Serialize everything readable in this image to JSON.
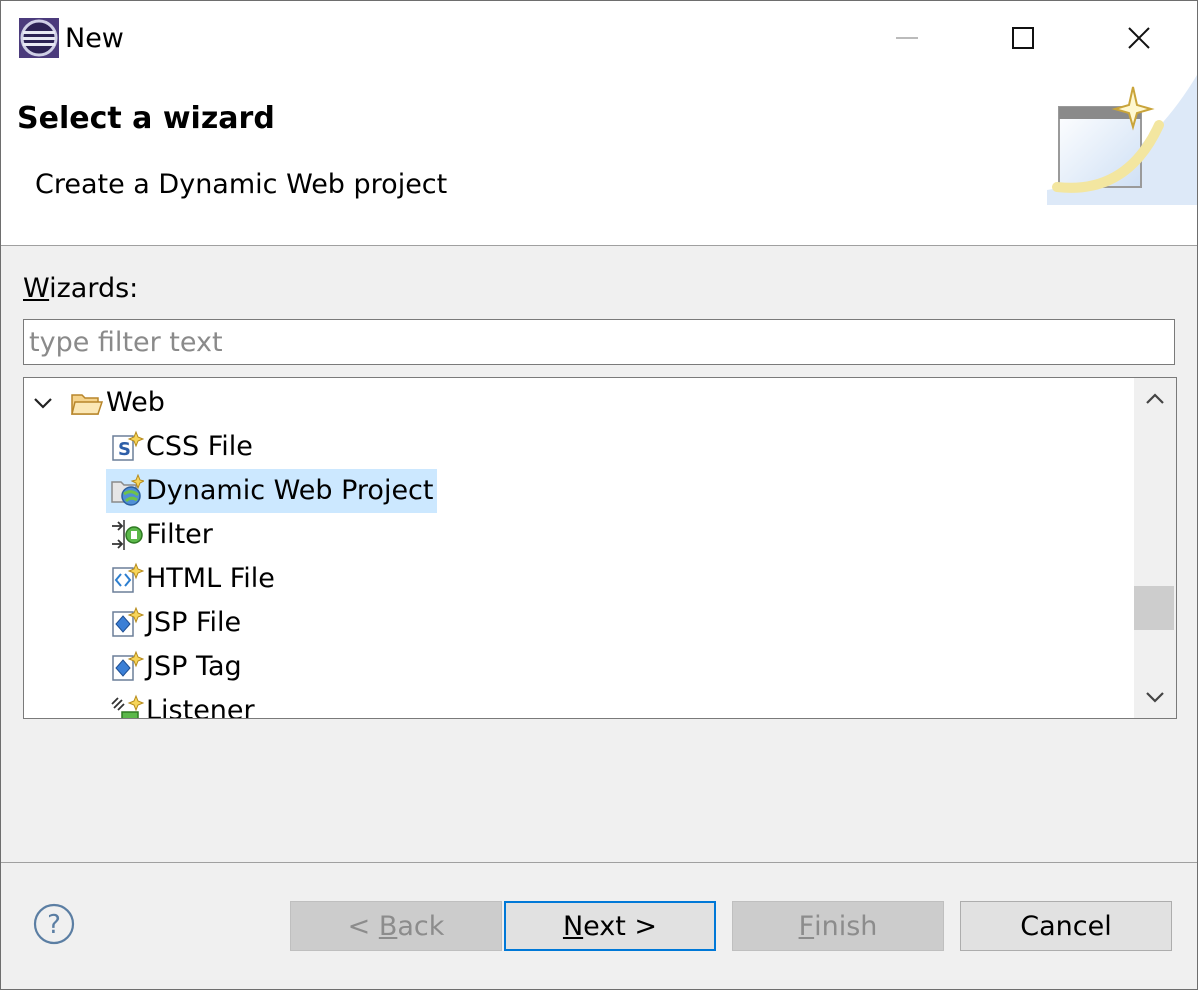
{
  "window": {
    "title": "New",
    "app_icon": "eclipse-icon",
    "controls": [
      "minimize-icon",
      "maximize-icon",
      "close-icon"
    ]
  },
  "header": {
    "title": "Select a wizard",
    "description": "Create a Dynamic Web project"
  },
  "wizards": {
    "label_mnemonic": "W",
    "label_rest": "izards:",
    "filter_placeholder": "type filter text",
    "filter_value": ""
  },
  "tree": {
    "group": {
      "label": "Web",
      "expanded": true,
      "icon": "open-folder-icon"
    },
    "items": [
      {
        "label": "CSS File",
        "icon": "css-file-icon"
      },
      {
        "label": "Dynamic Web Project",
        "icon": "dynamic-web-project-icon",
        "selected": true
      },
      {
        "label": "Filter",
        "icon": "filter-icon"
      },
      {
        "label": "HTML File",
        "icon": "html-file-icon"
      },
      {
        "label": "JSP File",
        "icon": "jsp-file-icon"
      },
      {
        "label": "JSP Tag",
        "icon": "jsp-tag-icon"
      },
      {
        "label": "Listener",
        "icon": "listener-icon"
      }
    ]
  },
  "buttons": {
    "back": {
      "prefix": "< ",
      "mnemonic": "B",
      "rest": "ack",
      "enabled": false
    },
    "next": {
      "mnemonic": "N",
      "rest": "ext >",
      "enabled": true,
      "default": true
    },
    "finish": {
      "mnemonic": "F",
      "rest": "inish",
      "enabled": false
    },
    "cancel": {
      "label": "Cancel",
      "enabled": true
    }
  },
  "colors": {
    "selection": "#cce8ff",
    "default_button_border": "#0078d7",
    "dialog_bg": "#f0f0f0"
  }
}
